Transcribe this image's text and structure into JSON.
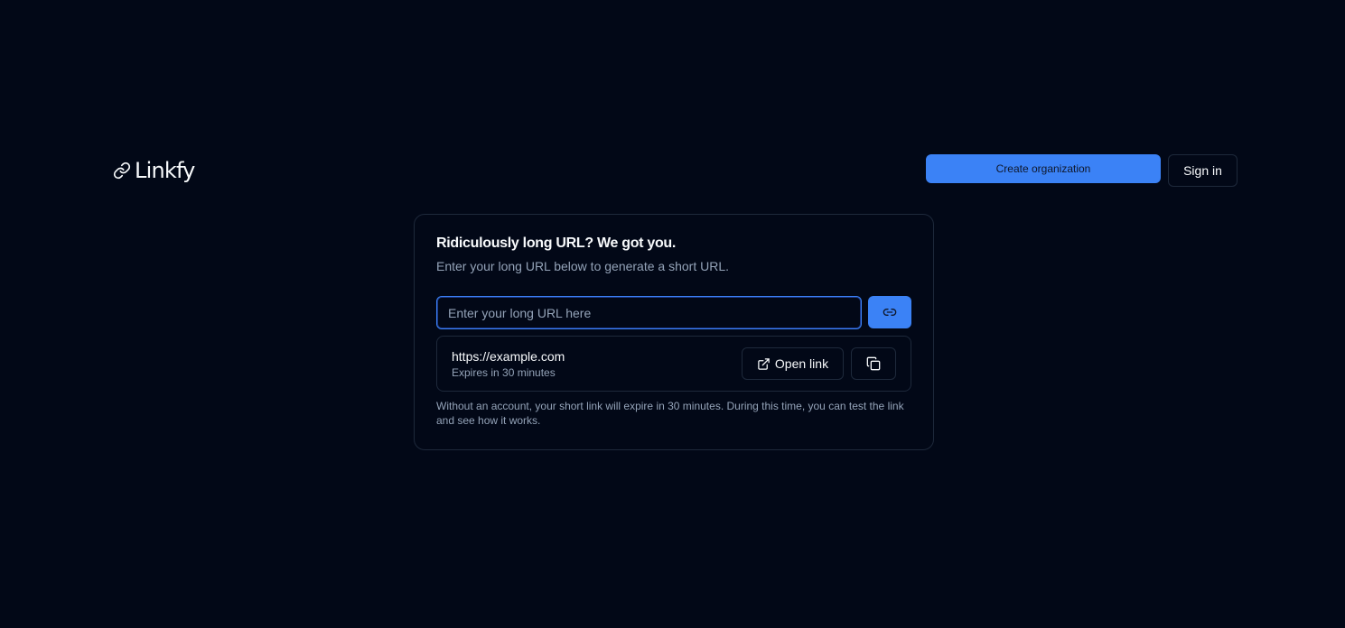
{
  "header": {
    "logo_text": "Linkfy",
    "create_org_label": "Create organization",
    "sign_in_label": "Sign in"
  },
  "card": {
    "title": "Ridiculously long URL? We got you.",
    "description": "Enter your long URL below to generate a short URL.",
    "input_placeholder": "Enter your long URL here",
    "input_value": "",
    "result": {
      "url": "https://example.com",
      "expiry": "Expires in 30 minutes",
      "open_label": "Open link"
    },
    "note": "Without an account, your short link will expire in 30 minutes. During this time, you can test the link and see how it works."
  },
  "icons": {
    "logo": "link-icon",
    "shorten": "link-icon",
    "open": "external-link-icon",
    "copy": "copy-icon"
  },
  "colors": {
    "background": "#020817",
    "accent": "#3b82f6",
    "border": "#1e293b",
    "muted_text": "#94a3b8",
    "text": "#f8fafc"
  }
}
